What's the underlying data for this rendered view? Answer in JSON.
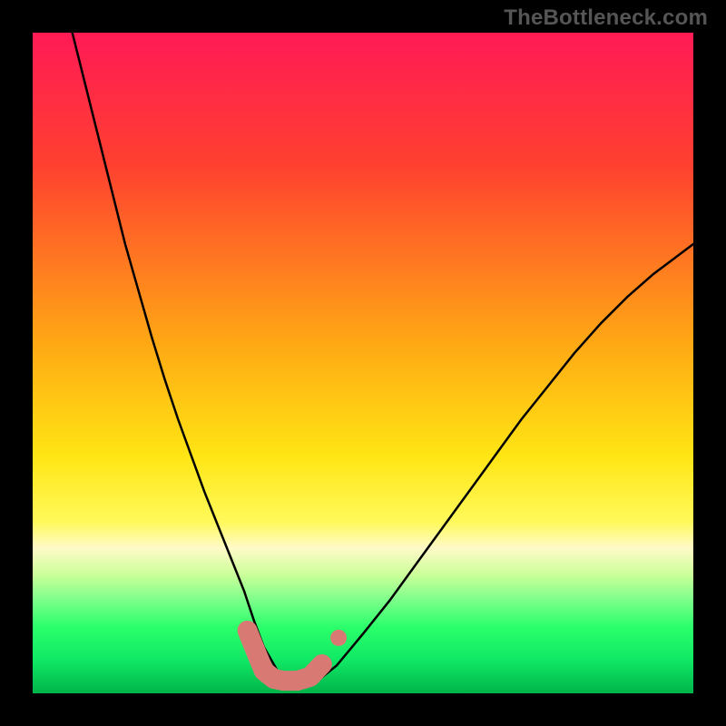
{
  "watermark": "TheBottleneck.com",
  "chart_data": {
    "type": "line",
    "title": "",
    "xlabel": "",
    "ylabel": "",
    "xlim": [
      0,
      100
    ],
    "ylim": [
      0,
      100
    ],
    "axis_visible": false,
    "gradient_stops": [
      {
        "offset": 0,
        "color": "#ff1a55"
      },
      {
        "offset": 20,
        "color": "#ff4030"
      },
      {
        "offset": 47,
        "color": "#ffa814"
      },
      {
        "offset": 64,
        "color": "#ffe514"
      },
      {
        "offset": 74,
        "color": "#fff95a"
      },
      {
        "offset": 78,
        "color": "#fffac8"
      },
      {
        "offset": 82,
        "color": "#ccff9a"
      },
      {
        "offset": 86,
        "color": "#7aff8a"
      },
      {
        "offset": 90,
        "color": "#2aff6a"
      },
      {
        "offset": 95,
        "color": "#10e865"
      },
      {
        "offset": 100,
        "color": "#00b44a"
      }
    ],
    "series": [
      {
        "name": "bottleneck-curve",
        "kind": "line",
        "color": "#000000",
        "x": [
          6,
          8,
          10,
          12,
          14,
          16,
          18,
          20,
          22,
          24,
          26,
          28,
          30,
          32,
          33.5,
          35,
          37,
          39,
          41,
          43,
          46,
          50,
          54,
          58,
          62,
          66,
          70,
          74,
          78,
          82,
          86,
          90,
          94,
          98,
          100
        ],
        "y": [
          100,
          92,
          84,
          76,
          68,
          61,
          54,
          47.5,
          41.5,
          36,
          30.5,
          25.5,
          20.5,
          15.5,
          11,
          7,
          3.5,
          1.8,
          0.9,
          1.8,
          4.2,
          9,
          14,
          19.5,
          25,
          30.5,
          36,
          41.5,
          46.5,
          51.5,
          56,
          60,
          63.5,
          66.5,
          68
        ]
      },
      {
        "name": "highlight-segment",
        "kind": "line",
        "color": "#d87a73",
        "stroke_width": 22,
        "x": [
          32.5,
          34,
          35,
          36.5,
          38,
          40,
          42,
          43.8
        ],
        "y": [
          9.5,
          5.8,
          3.4,
          2.2,
          1.9,
          1.9,
          2.5,
          4.4
        ]
      },
      {
        "name": "highlight-marker",
        "kind": "scatter",
        "color": "#d87a73",
        "radius": 9,
        "x": [
          46.3
        ],
        "y": [
          8.4
        ]
      }
    ]
  }
}
